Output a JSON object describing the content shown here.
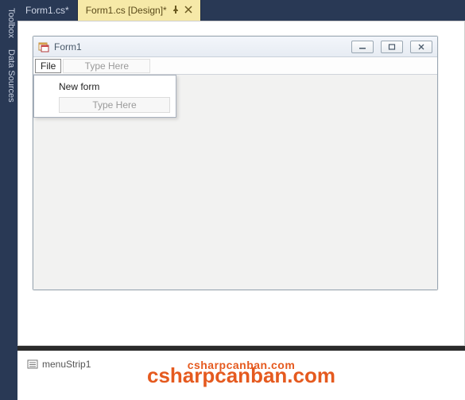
{
  "sidebar": {
    "tabs": [
      "Toolbox",
      "Data Sources"
    ]
  },
  "tabs": [
    {
      "label": "Form1.cs*"
    },
    {
      "label": "Form1.cs [Design]*"
    }
  ],
  "form": {
    "title": "Form1",
    "menu": {
      "file_label": "File",
      "type_here": "Type Here",
      "dropdown": {
        "new_form": "New form",
        "type_here": "Type Here"
      }
    }
  },
  "tray": {
    "menu_strip": "menuStrip1"
  },
  "watermark": {
    "small": "csharpcanban.com",
    "large": "csharpcanban.com"
  }
}
